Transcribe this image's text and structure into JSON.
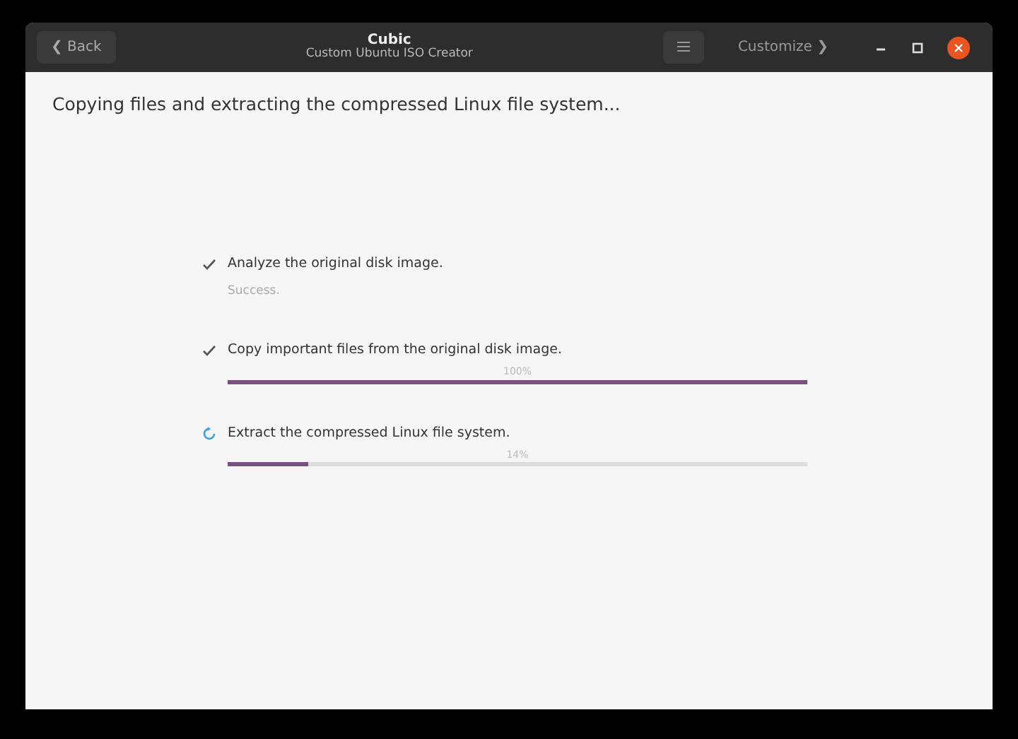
{
  "window": {
    "title": "Cubic",
    "subtitle": "Custom Ubuntu ISO Creator"
  },
  "header_buttons": {
    "back": "❮ Back",
    "customize": "Customize ❯"
  },
  "heading": "Copying files and extracting the compressed Linux file system...",
  "steps": [
    {
      "kind": "done",
      "label": "Analyze the original disk image.",
      "status": "Success."
    },
    {
      "kind": "done",
      "label": "Copy important files from the original disk image.",
      "progress": "100%",
      "level": 1.0
    },
    {
      "kind": "running",
      "label": "Extract the compressed Linux file system.",
      "progress": "14%",
      "level": 0.14
    }
  ]
}
